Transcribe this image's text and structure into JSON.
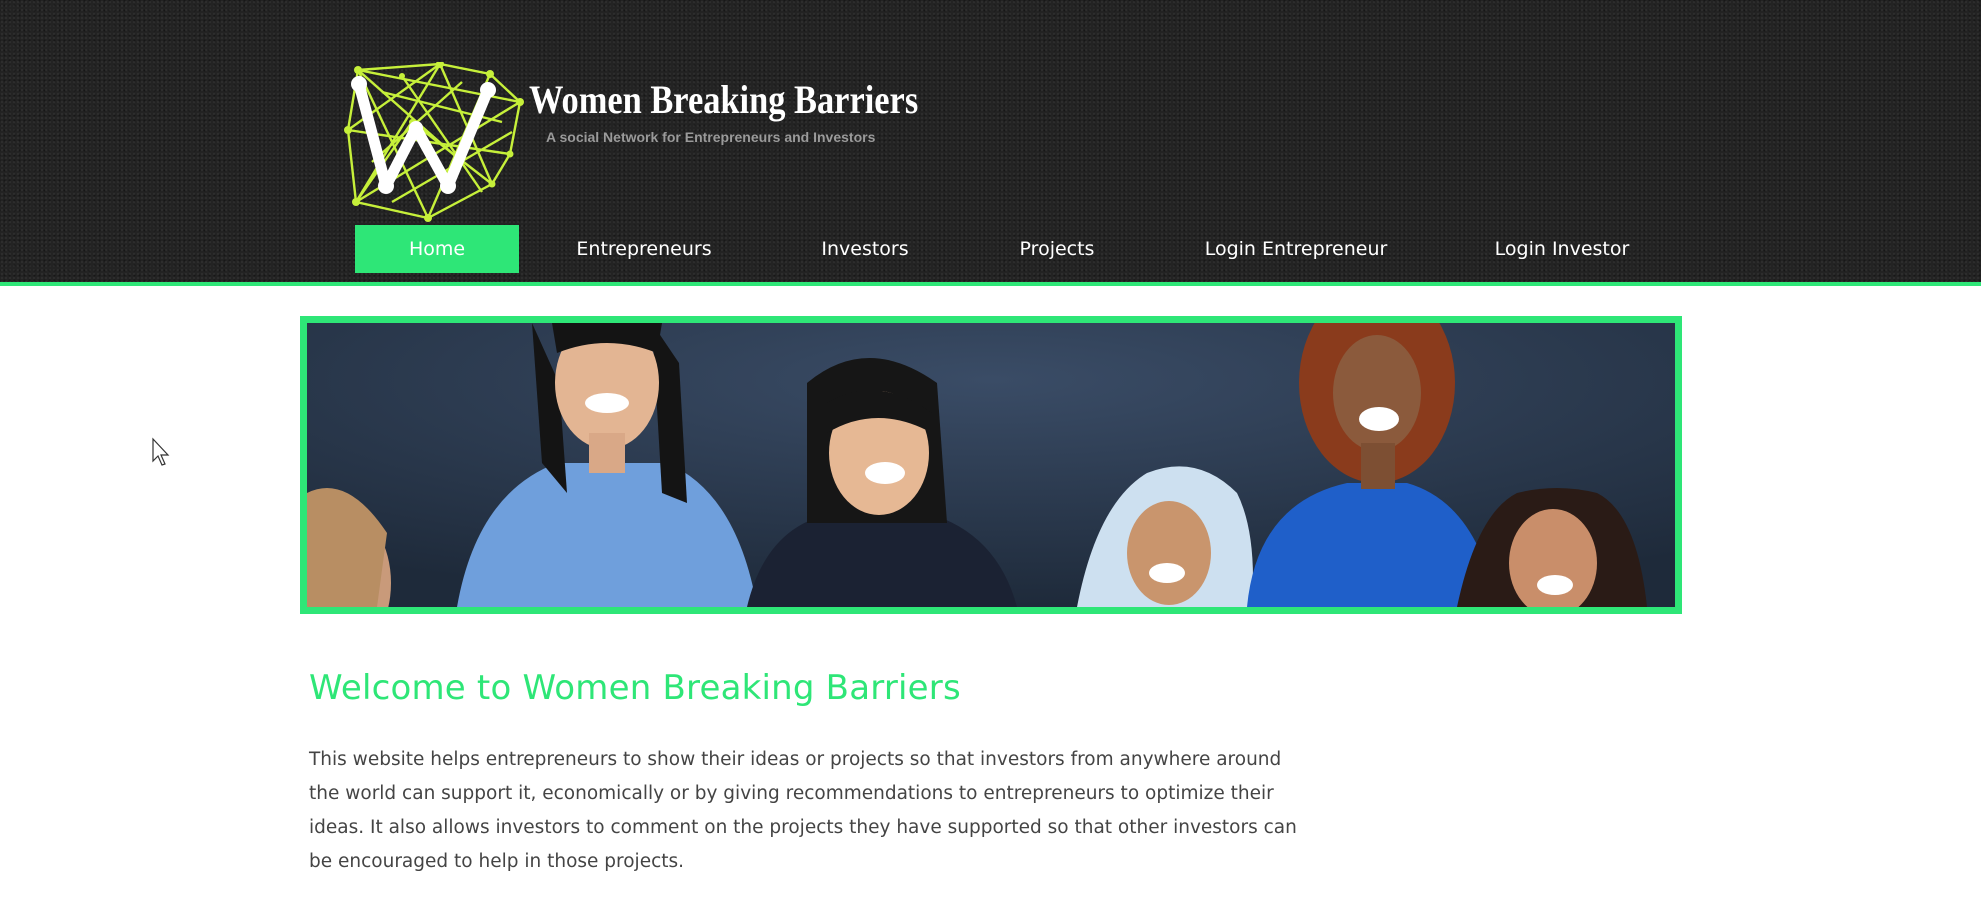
{
  "site": {
    "title": "Women Breaking Barriers",
    "tagline": "A social Network for Entrepreneurs and Investors",
    "logo_icon": "network-w-logo-icon"
  },
  "nav": {
    "items": [
      {
        "label": "Home",
        "active": true
      },
      {
        "label": "Entrepreneurs",
        "active": false
      },
      {
        "label": "Investors",
        "active": false
      },
      {
        "label": "Projects",
        "active": false
      },
      {
        "label": "Login Entrepreneur",
        "active": false
      },
      {
        "label": "Login Investor",
        "active": false
      }
    ]
  },
  "hero": {
    "description": "banner-photo"
  },
  "main": {
    "heading": "Welcome to Women Breaking Barriers",
    "intro": "This website helps entrepreneurs to show their ideas or projects so that investors from anywhere around the world can support it, economically or by giving recommendations to entrepreneurs to optimize their ideas. It also allows investors to comment on the projects they have supported so that other investors can be encouraged to help in those projects."
  },
  "colors": {
    "accent": "#2ee677",
    "header_bg": "#232323",
    "logo_lines": "#c6f03a",
    "text": "#444444",
    "white": "#ffffff"
  }
}
